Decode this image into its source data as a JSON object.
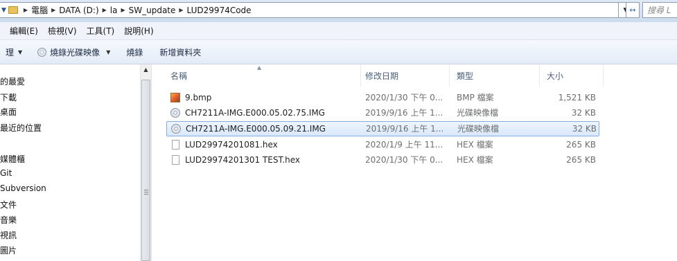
{
  "address": {
    "crumbs": [
      "電腦",
      "DATA (D:)",
      "la",
      "SW_update",
      "LUD29974Code"
    ],
    "search_placeholder": "搜尋 L"
  },
  "menu": [
    "編輯(E)",
    "檢視(V)",
    "工具(T)",
    "說明(H)"
  ],
  "toolbar": {
    "organize_label": "理",
    "burn_image_label": "燒錄光碟映像",
    "burn_label": "燒錄",
    "new_folder_label": "新增資料夾"
  },
  "nav": {
    "items": [
      "的最愛",
      "下載",
      "桌面",
      "最近的位置",
      "媒體櫃",
      "Git",
      "Subversion",
      "文件",
      "音樂",
      "視訊",
      "圖片"
    ]
  },
  "columns": {
    "name": "名稱",
    "date": "修改日期",
    "type": "類型",
    "size": "大小"
  },
  "files": [
    {
      "name": "9.bmp",
      "date": "2020/1/30 下午 0...",
      "type": "BMP 檔案",
      "size": "1,521 KB",
      "icon": "bmp-file-icon"
    },
    {
      "name": "CH7211A-IMG.E000.05.02.75.IMG",
      "date": "2019/9/16 上午 1...",
      "type": "光碟映像檔",
      "size": "32 KB",
      "icon": "disc-image-icon"
    },
    {
      "name": "CH7211A-IMG.E000.05.09.21.IMG",
      "date": "2019/9/16 上午 1...",
      "type": "光碟映像檔",
      "size": "32 KB",
      "icon": "disc-image-icon",
      "selected": true
    },
    {
      "name": "LUD29974201081.hex",
      "date": "2020/1/9 上午 11...",
      "type": "HEX 檔案",
      "size": "265 KB",
      "icon": "file-icon"
    },
    {
      "name": "LUD29974201301 TEST.hex",
      "date": "2020/1/30 下午 0...",
      "type": "HEX 檔案",
      "size": "265 KB",
      "icon": "file-icon"
    }
  ]
}
